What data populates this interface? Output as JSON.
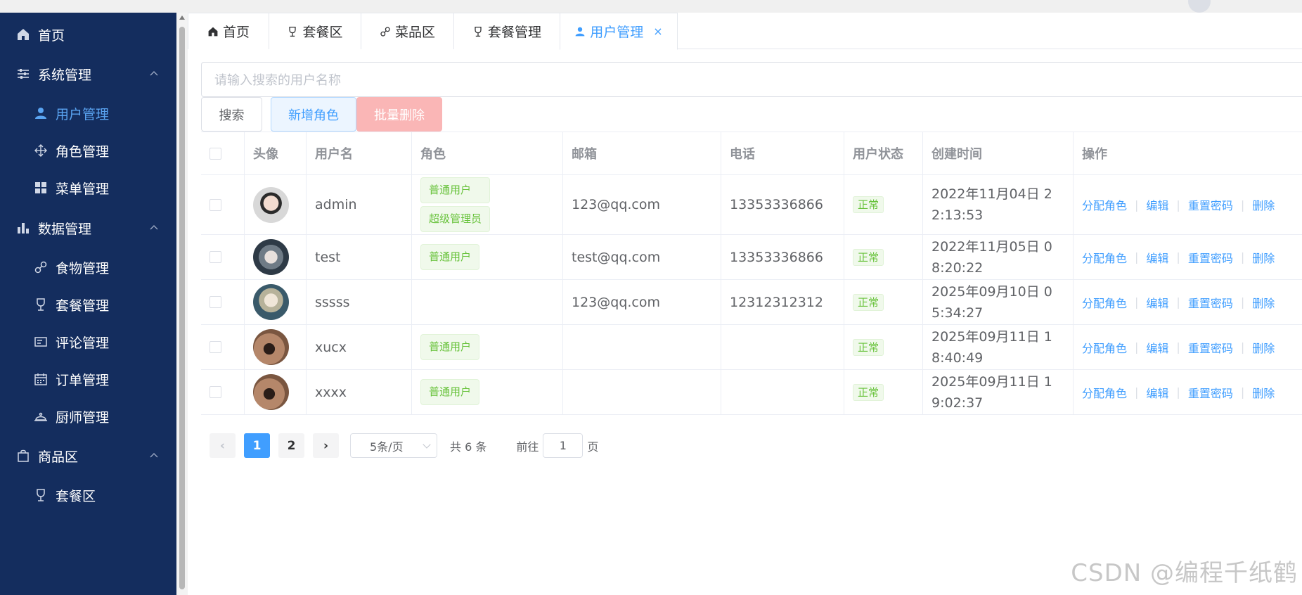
{
  "sidebar": {
    "items": [
      {
        "label": "首页",
        "icon": "home-icon"
      },
      {
        "label": "系统管理",
        "icon": "sliders-icon"
      },
      {
        "label": "用户管理",
        "icon": "user-icon"
      },
      {
        "label": "角色管理",
        "icon": "move-icon"
      },
      {
        "label": "菜单管理",
        "icon": "grid-icon"
      },
      {
        "label": "数据管理",
        "icon": "bar-chart-icon"
      },
      {
        "label": "食物管理",
        "icon": "link-icon"
      },
      {
        "label": "套餐管理",
        "icon": "cup-icon"
      },
      {
        "label": "评论管理",
        "icon": "comment-icon"
      },
      {
        "label": "订单管理",
        "icon": "calendar-icon"
      },
      {
        "label": "厨师管理",
        "icon": "cloche-icon"
      },
      {
        "label": "商品区",
        "icon": "bag-icon"
      },
      {
        "label": "套餐区",
        "icon": "cup-icon"
      }
    ]
  },
  "tabs": [
    {
      "label": "首页"
    },
    {
      "label": "套餐区"
    },
    {
      "label": "菜品区"
    },
    {
      "label": "套餐管理"
    },
    {
      "label": "用户管理",
      "close": "×"
    }
  ],
  "search": {
    "placeholder": "请输入搜索的用户名称"
  },
  "buttons": {
    "search": "搜索",
    "add": "新增角色",
    "batch_delete": "批量删除"
  },
  "table": {
    "headers": {
      "avatar": "头像",
      "username": "用户名",
      "role": "角色",
      "email": "邮箱",
      "phone": "电话",
      "status": "用户状态",
      "created": "创建时间",
      "ops": "操作"
    },
    "rows": [
      {
        "username": "admin",
        "roles": [
          "普通用户",
          "超级管理员"
        ],
        "email": "123@qq.com",
        "phone": "13353336866",
        "status": "正常",
        "created": "2022年11月04日 22:13:53"
      },
      {
        "username": "test",
        "roles": [
          "普通用户"
        ],
        "email": "test@qq.com",
        "phone": "13353336866",
        "status": "正常",
        "created": "2022年11月05日 08:20:22"
      },
      {
        "username": "sssss",
        "roles": [],
        "email": "123@qq.com",
        "phone": "12312312312",
        "status": "正常",
        "created": "2025年09月10日 05:34:27"
      },
      {
        "username": "xucx",
        "roles": [
          "普通用户"
        ],
        "email": "",
        "phone": "",
        "status": "正常",
        "created": "2025年09月11日 18:40:49"
      },
      {
        "username": "xxxx",
        "roles": [
          "普通用户"
        ],
        "email": "",
        "phone": "",
        "status": "正常",
        "created": "2025年09月11日 19:02:37"
      }
    ],
    "ops": {
      "assign": "分配角色",
      "edit": "编辑",
      "reset": "重置密码",
      "delete": "删除",
      "sep": "|"
    }
  },
  "pagination": {
    "prev": "‹",
    "pages": [
      "1",
      "2"
    ],
    "current": "1",
    "next": "›",
    "page_size": "5条/页",
    "total": "共 6 条",
    "goto": "前往",
    "goto_value": "1",
    "page_unit": "页"
  },
  "watermark": "CSDN @编程千纸鹤",
  "colors": {
    "sidebar_bg": "#142d5e",
    "accent": "#409eff",
    "success": "#67c23a",
    "danger_light": "#fab6b6"
  }
}
